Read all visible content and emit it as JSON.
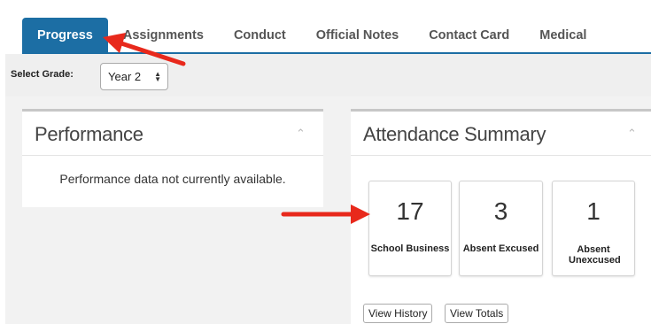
{
  "tabs": [
    {
      "label": "Progress",
      "active": true
    },
    {
      "label": "Assignments",
      "active": false
    },
    {
      "label": "Conduct",
      "active": false
    },
    {
      "label": "Official Notes",
      "active": false
    },
    {
      "label": "Contact Card",
      "active": false
    },
    {
      "label": "Medical",
      "active": false
    }
  ],
  "grade": {
    "label": "Select Grade:",
    "selected": "Year 2"
  },
  "performance": {
    "title": "Performance",
    "message": "Performance data not currently available."
  },
  "attendance": {
    "title": "Attendance Summary",
    "cards": [
      {
        "count": "17",
        "label": "School Business"
      },
      {
        "count": "3",
        "label": "Absent Excused"
      },
      {
        "count": "1",
        "label": "Absent Unexcused"
      }
    ],
    "buttons": {
      "history": "View History",
      "totals": "View Totals"
    }
  },
  "colors": {
    "accent": "#1c6ea4",
    "annotation": "#e8291c"
  }
}
